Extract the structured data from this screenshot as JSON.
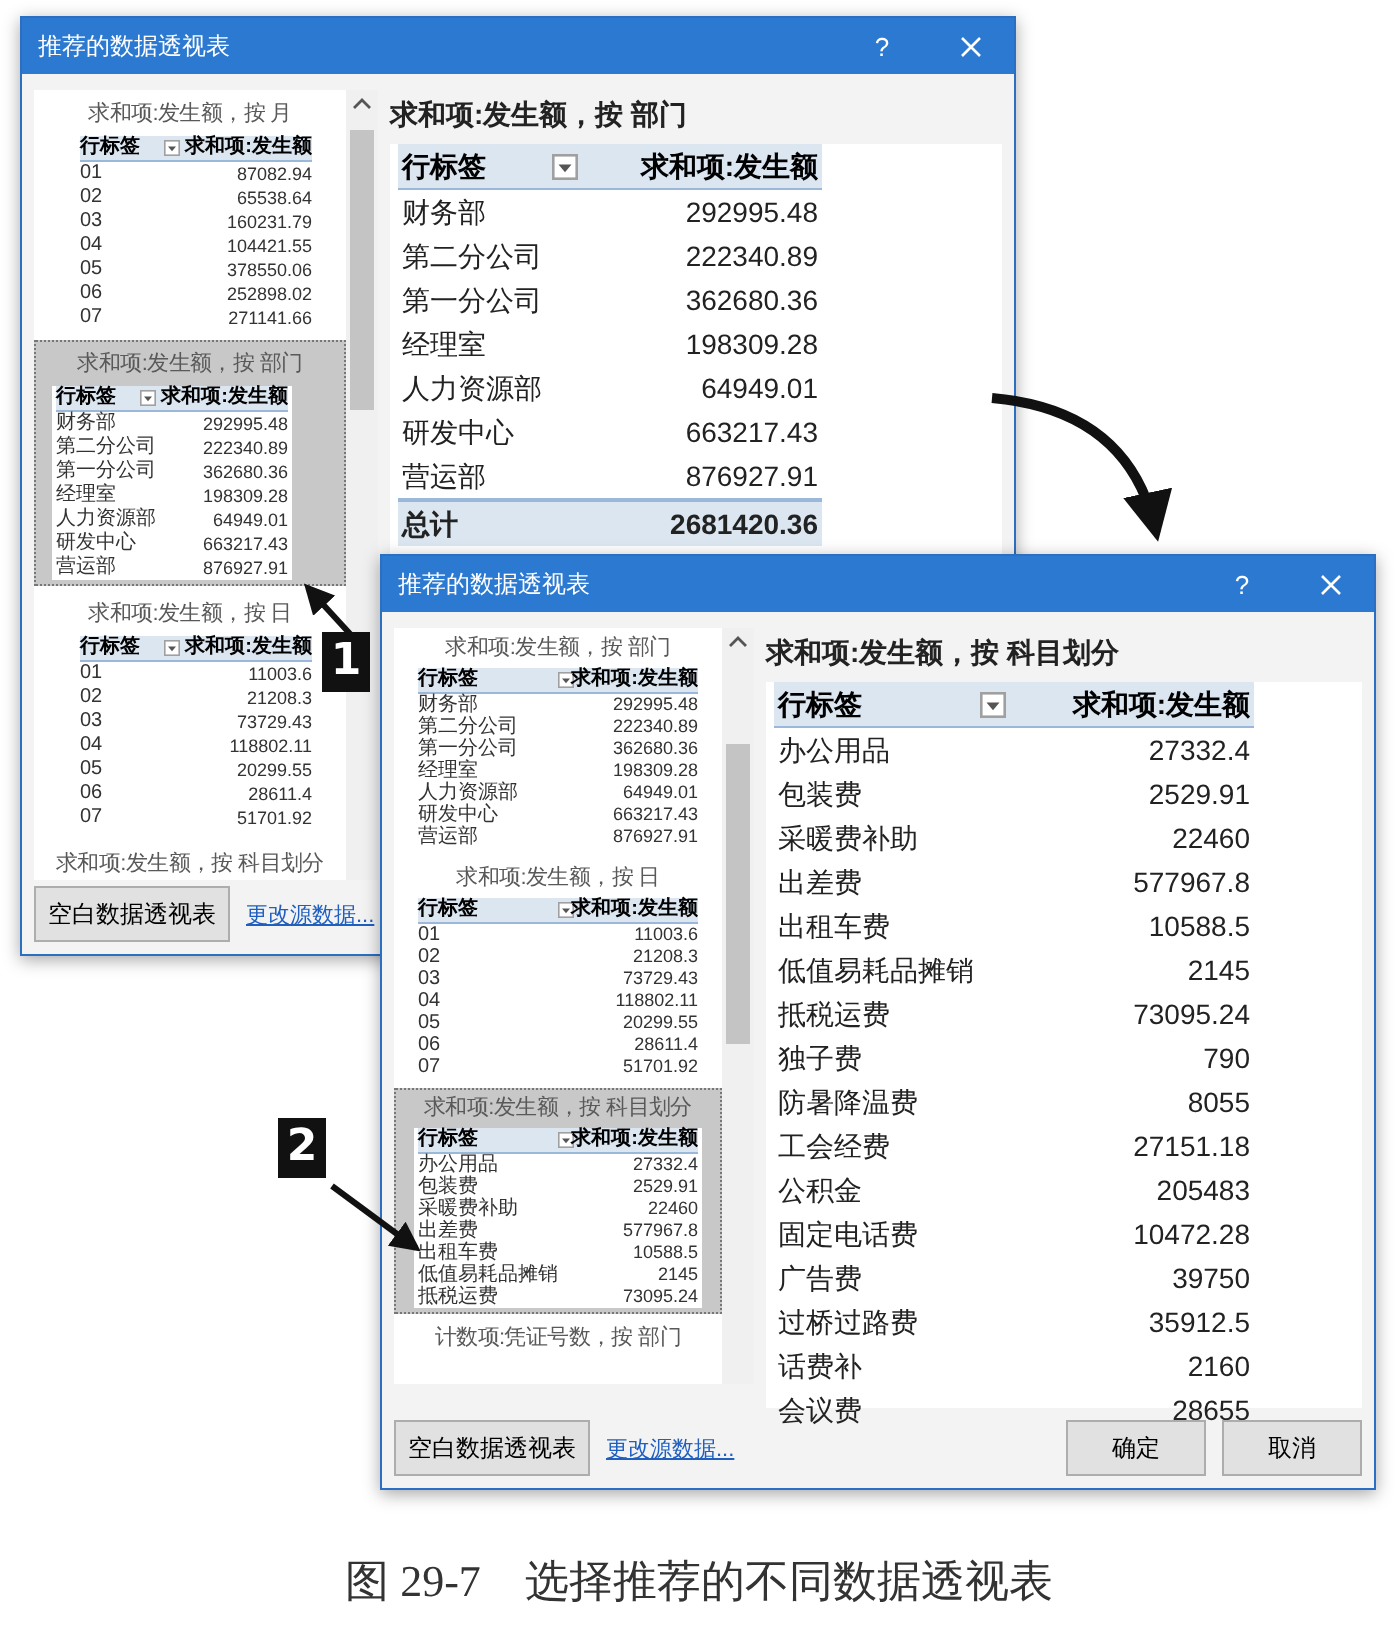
{
  "dialogs": [
    {
      "title": "推荐的数据透视表",
      "help": "?",
      "list": [
        {
          "label": "求和项:发生额，按 月",
          "selected": false,
          "preview": {
            "columns": [
              "行标签",
              "求和项:发生额"
            ],
            "rows": [
              [
                "01",
                "87082.94"
              ],
              [
                "02",
                "65538.64"
              ],
              [
                "03",
                "160231.79"
              ],
              [
                "04",
                "104421.55"
              ],
              [
                "05",
                "378550.06"
              ],
              [
                "06",
                "252898.02"
              ],
              [
                "07",
                "271141.66"
              ]
            ]
          }
        },
        {
          "label": "求和项:发生额，按 部门",
          "selected": true,
          "preview": {
            "columns": [
              "行标签",
              "求和项:发生额"
            ],
            "rows": [
              [
                "财务部",
                "292995.48"
              ],
              [
                "第二分公司",
                "222340.89"
              ],
              [
                "第一分公司",
                "362680.36"
              ],
              [
                "经理室",
                "198309.28"
              ],
              [
                "人力资源部",
                "64949.01"
              ],
              [
                "研发中心",
                "663217.43"
              ],
              [
                "营运部",
                "876927.91"
              ]
            ]
          }
        },
        {
          "label": "求和项:发生额，按 日",
          "selected": false,
          "preview": {
            "columns": [
              "行标签",
              "求和项:发生额"
            ],
            "rows": [
              [
                "01",
                "11003.6"
              ],
              [
                "02",
                "21208.3"
              ],
              [
                "03",
                "73729.43"
              ],
              [
                "04",
                "118802.11"
              ],
              [
                "05",
                "20299.55"
              ],
              [
                "06",
                "28611.4"
              ],
              [
                "07",
                "51701.92"
              ]
            ]
          }
        },
        {
          "label": "求和项:发生额，按 科目划分",
          "selected": false
        }
      ],
      "preview_title": "求和项:发生额，按 部门",
      "table": {
        "columns": [
          "行标签",
          "求和项:发生额"
        ],
        "rows": [
          [
            "财务部",
            "292995.48"
          ],
          [
            "第二分公司",
            "222340.89"
          ],
          [
            "第一分公司",
            "362680.36"
          ],
          [
            "经理室",
            "198309.28"
          ],
          [
            "人力资源部",
            "64949.01"
          ],
          [
            "研发中心",
            "663217.43"
          ],
          [
            "营运部",
            "876927.91"
          ]
        ],
        "total": [
          "总计",
          "2681420.36"
        ]
      },
      "blank_button": "空白数据透视表",
      "source_link": "更改源数据..."
    },
    {
      "title": "推荐的数据透视表",
      "help": "?",
      "list": [
        {
          "label": "求和项:发生额，按 部门",
          "selected": false,
          "preview": {
            "columns": [
              "行标签",
              "求和项:发生额"
            ],
            "rows": [
              [
                "财务部",
                "292995.48"
              ],
              [
                "第二分公司",
                "222340.89"
              ],
              [
                "第一分公司",
                "362680.36"
              ],
              [
                "经理室",
                "198309.28"
              ],
              [
                "人力资源部",
                "64949.01"
              ],
              [
                "研发中心",
                "663217.43"
              ],
              [
                "营运部",
                "876927.91"
              ]
            ]
          }
        },
        {
          "label": "求和项:发生额，按 日",
          "selected": false,
          "preview": {
            "columns": [
              "行标签",
              "求和项:发生额"
            ],
            "rows": [
              [
                "01",
                "11003.6"
              ],
              [
                "02",
                "21208.3"
              ],
              [
                "03",
                "73729.43"
              ],
              [
                "04",
                "118802.11"
              ],
              [
                "05",
                "20299.55"
              ],
              [
                "06",
                "28611.4"
              ],
              [
                "07",
                "51701.92"
              ]
            ]
          }
        },
        {
          "label": "求和项:发生额，按 科目划分",
          "selected": true,
          "preview": {
            "columns": [
              "行标签",
              "求和项:发生额"
            ],
            "rows": [
              [
                "办公用品",
                "27332.4"
              ],
              [
                "包装费",
                "2529.91"
              ],
              [
                "采暖费补助",
                "22460"
              ],
              [
                "出差费",
                "577967.8"
              ],
              [
                "出租车费",
                "10588.5"
              ],
              [
                "低值易耗品摊销",
                "2145"
              ],
              [
                "抵税运费",
                "73095.24"
              ]
            ]
          }
        },
        {
          "label": "计数项:凭证号数，按 部门",
          "selected": false
        }
      ],
      "preview_title": "求和项:发生额，按 科目划分",
      "table": {
        "columns": [
          "行标签",
          "求和项:发生额"
        ],
        "rows": [
          [
            "办公用品",
            "27332.4"
          ],
          [
            "包装费",
            "2529.91"
          ],
          [
            "采暖费补助",
            "22460"
          ],
          [
            "出差费",
            "577967.8"
          ],
          [
            "出租车费",
            "10588.5"
          ],
          [
            "低值易耗品摊销",
            "2145"
          ],
          [
            "抵税运费",
            "73095.24"
          ],
          [
            "独子费",
            "790"
          ],
          [
            "防暑降温费",
            "8055"
          ],
          [
            "工会经费",
            "27151.18"
          ],
          [
            "公积金",
            "205483"
          ],
          [
            "固定电话费",
            "10472.28"
          ],
          [
            "广告费",
            "39750"
          ],
          [
            "过桥过路费",
            "35912.5"
          ],
          [
            "话费补",
            "2160"
          ],
          [
            "会议费",
            "28655"
          ]
        ]
      },
      "blank_button": "空白数据透视表",
      "source_link": "更改源数据...",
      "buttons": [
        "确定",
        "取消"
      ]
    }
  ],
  "callouts": [
    {
      "label": "1"
    },
    {
      "label": "2"
    }
  ],
  "caption": "图 29-7　选择推荐的不同数据透视表"
}
